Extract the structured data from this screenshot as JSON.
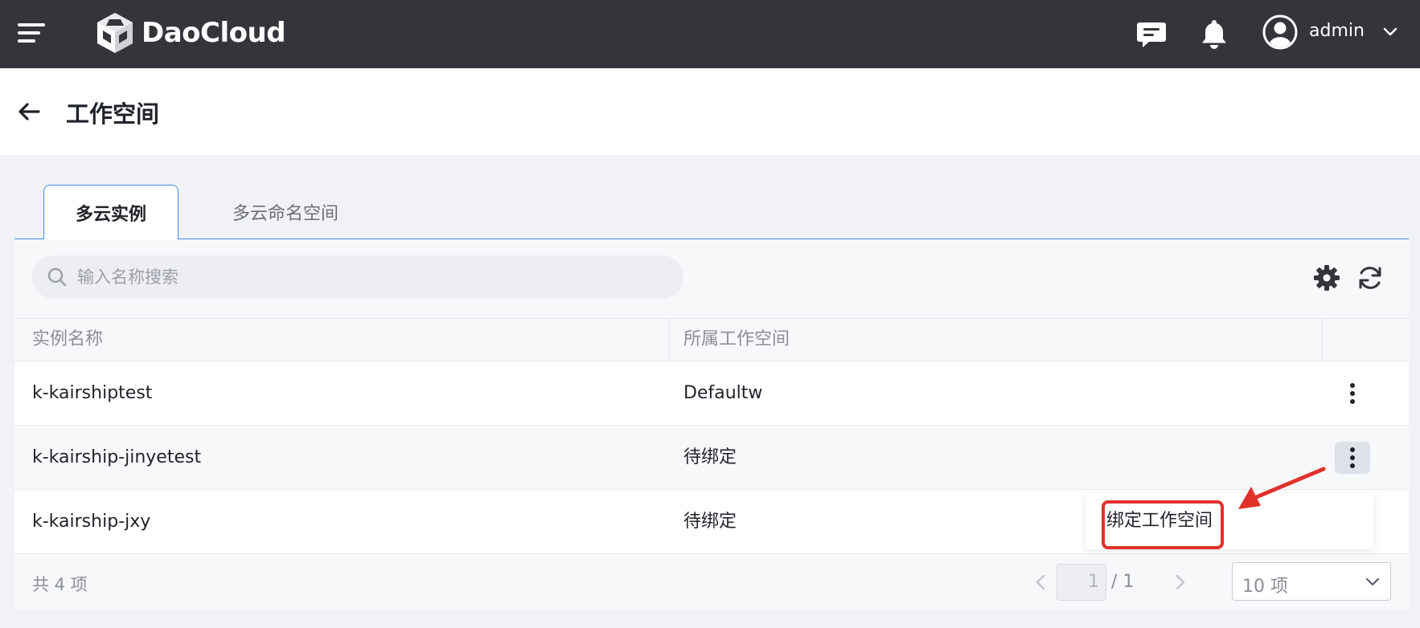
{
  "app": {
    "brand": "DaoCloud"
  },
  "topbar": {
    "user": {
      "name": "admin"
    },
    "icons": [
      "menu-icon",
      "message-icon",
      "bell-icon",
      "user-avatar-icon",
      "chevron-down-icon"
    ]
  },
  "header": {
    "title": "工作空间"
  },
  "tabs": [
    {
      "label": "多云实例",
      "active": true
    },
    {
      "label": "多云命名空间",
      "active": false
    }
  ],
  "search": {
    "placeholder": "输入名称搜索",
    "value": ""
  },
  "table": {
    "columns": [
      "实例名称",
      "所属工作空间"
    ],
    "rows": [
      {
        "name": "k-kairshiptest",
        "workspace": "Defaultw"
      },
      {
        "name": "k-kairship-jinyetest",
        "workspace": "待绑定"
      },
      {
        "name": "k-kairship-jxy",
        "workspace": "待绑定"
      }
    ]
  },
  "menu": {
    "items": [
      "绑定工作空间"
    ]
  },
  "footer": {
    "total": "共 4 项",
    "page": "1",
    "page_total": "/ 1",
    "page_size": "10 项"
  },
  "colors": {
    "topbar": "#33353b",
    "accent": "#3c8ee8",
    "highlight": "#e0312b"
  }
}
